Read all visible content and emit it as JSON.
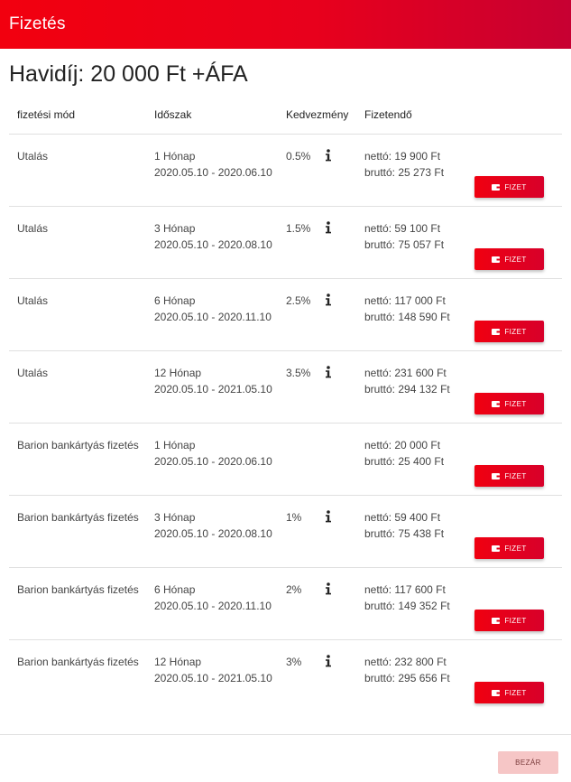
{
  "header": {
    "title": "Fizetés"
  },
  "price_title": "Havidíj: 20 000 Ft +ÁFA",
  "table": {
    "headers": {
      "method": "fizetési mód",
      "period": "Időszak",
      "discount": "Kedvezmény",
      "payable": "Fizetendő"
    },
    "rows": [
      {
        "method": "Utalás",
        "period": "1 Hónap",
        "dates": "2020.05.10 - 2020.06.10",
        "discount": "0.5%",
        "has_info": true,
        "net": "nettó: 19 900 Ft",
        "gross": "bruttó: 25 273 Ft",
        "button": "FIZET"
      },
      {
        "method": "Utalás",
        "period": "3 Hónap",
        "dates": "2020.05.10 - 2020.08.10",
        "discount": "1.5%",
        "has_info": true,
        "net": "nettó: 59 100 Ft",
        "gross": "bruttó: 75 057 Ft",
        "button": "FIZET"
      },
      {
        "method": "Utalás",
        "period": "6 Hónap",
        "dates": "2020.05.10 - 2020.11.10",
        "discount": "2.5%",
        "has_info": true,
        "net": "nettó: 117 000 Ft",
        "gross": "bruttó: 148 590 Ft",
        "button": "FIZET"
      },
      {
        "method": "Utalás",
        "period": "12 Hónap",
        "dates": "2020.05.10 - 2021.05.10",
        "discount": "3.5%",
        "has_info": true,
        "net": "nettó: 231 600 Ft",
        "gross": "bruttó: 294 132 Ft",
        "button": "FIZET"
      },
      {
        "method": "Barion bankártyás fizetés",
        "period": "1 Hónap",
        "dates": "2020.05.10 - 2020.06.10",
        "discount": "",
        "has_info": false,
        "net": "nettó: 20 000 Ft",
        "gross": "bruttó: 25 400 Ft",
        "button": "FIZET"
      },
      {
        "method": "Barion bankártyás fizetés",
        "period": "3 Hónap",
        "dates": "2020.05.10 - 2020.08.10",
        "discount": "1%",
        "has_info": true,
        "net": "nettó: 59 400 Ft",
        "gross": "bruttó: 75 438 Ft",
        "button": "FIZET"
      },
      {
        "method": "Barion bankártyás fizetés",
        "period": "6 Hónap",
        "dates": "2020.05.10 - 2020.11.10",
        "discount": "2%",
        "has_info": true,
        "net": "nettó: 117 600 Ft",
        "gross": "bruttó: 149 352 Ft",
        "button": "FIZET"
      },
      {
        "method": "Barion bankártyás fizetés",
        "period": "12 Hónap",
        "dates": "2020.05.10 - 2021.05.10",
        "discount": "3%",
        "has_info": true,
        "net": "nettó: 232 800 Ft",
        "gross": "bruttó: 295 656 Ft",
        "button": "FIZET"
      }
    ]
  },
  "footer": {
    "close_label": "BEZÁR"
  },
  "colors": {
    "brand_red": "#f00010",
    "brand_dark_red": "#c70032",
    "close_bg": "#f6c6c6"
  },
  "icons": {
    "info": "info-icon",
    "wallet": "wallet-icon"
  }
}
